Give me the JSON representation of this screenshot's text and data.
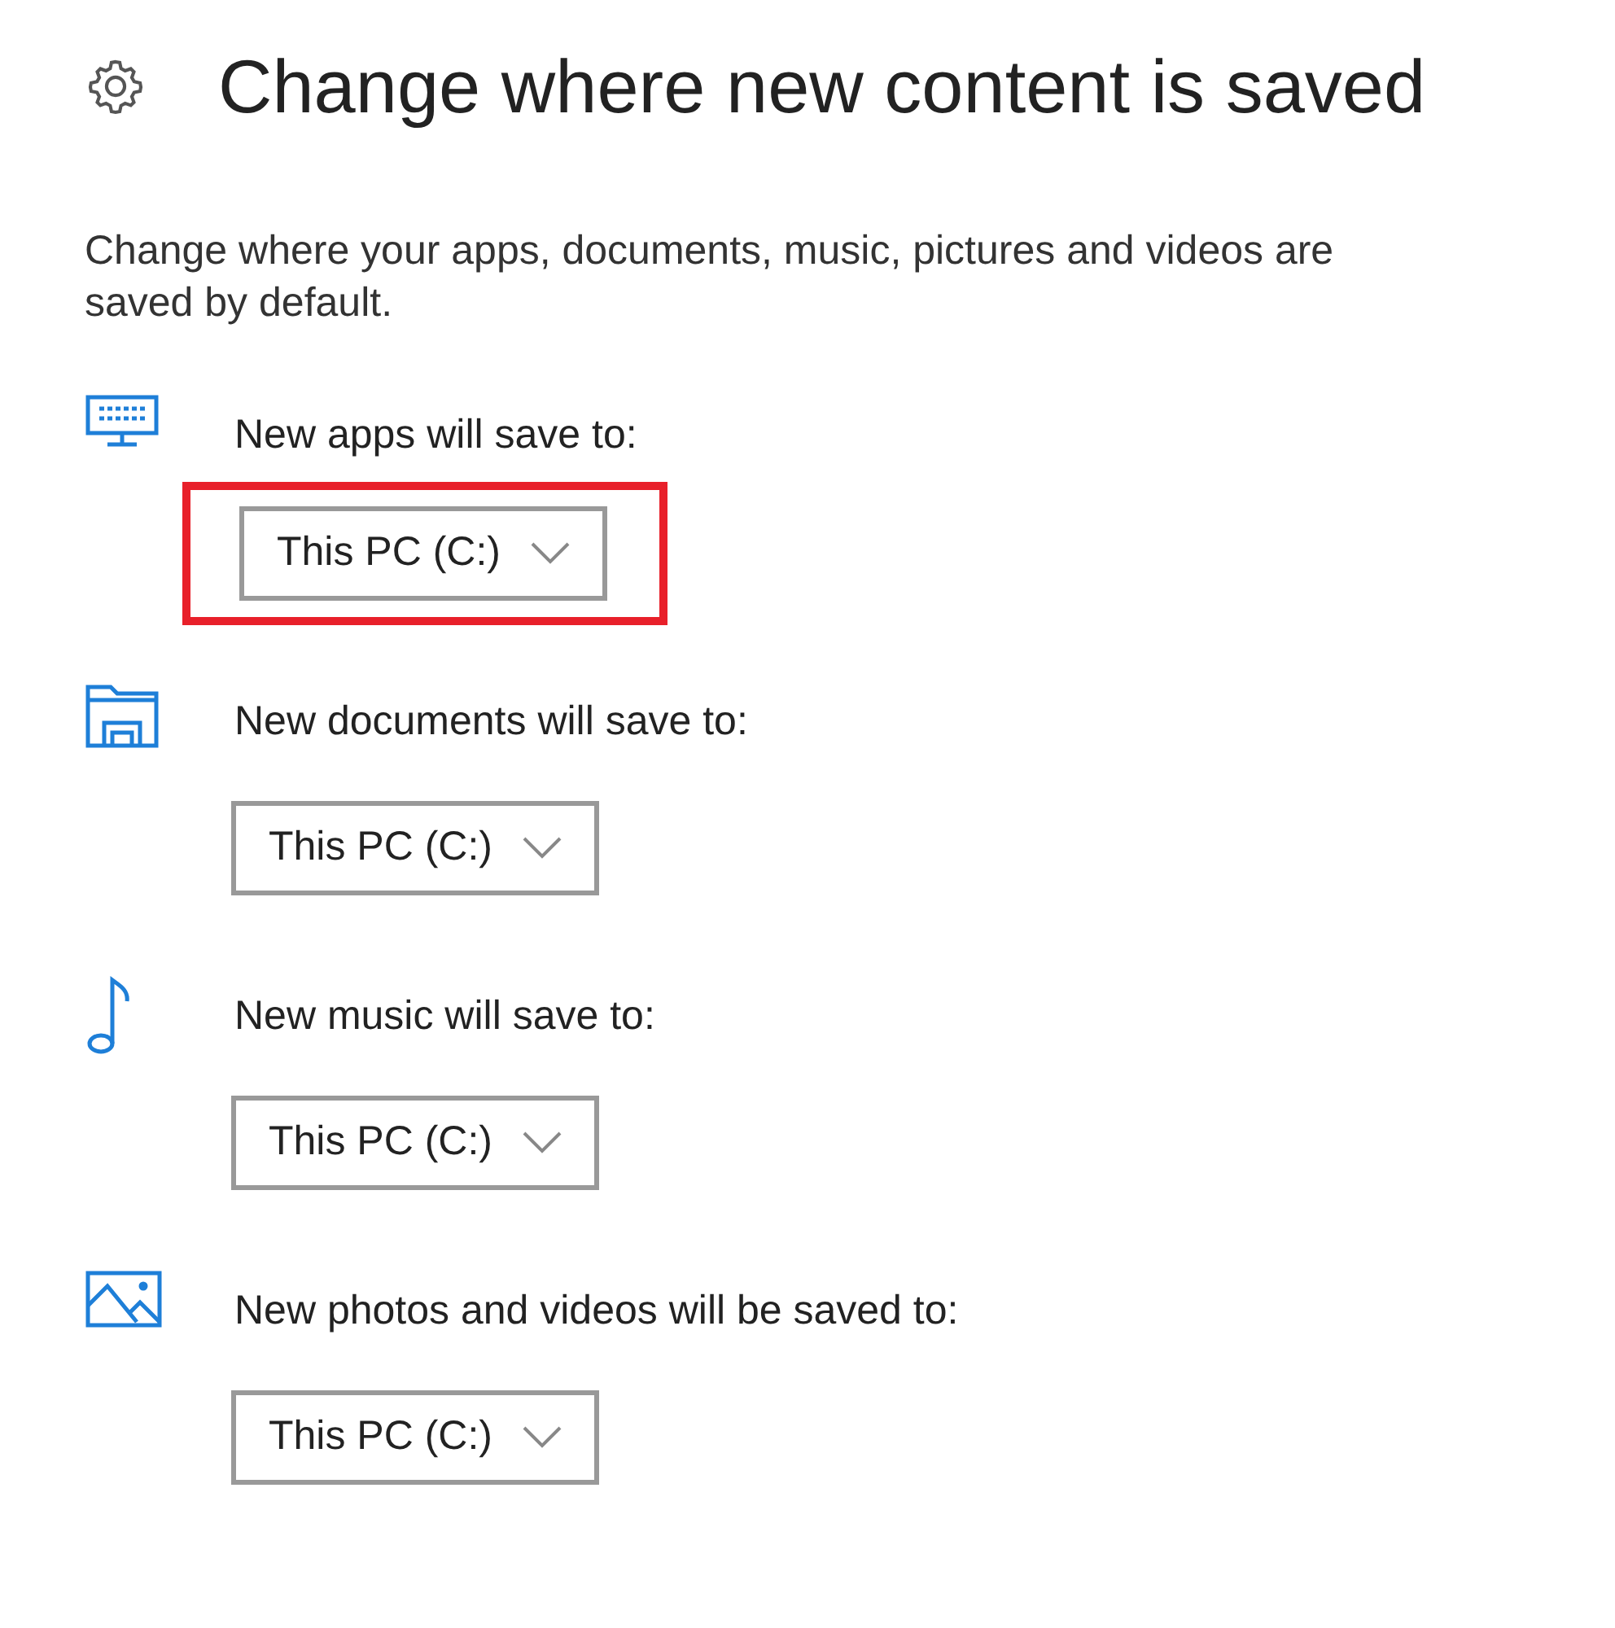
{
  "page": {
    "title": "Change where new content is saved",
    "description": "Change where your apps, documents, music, pictures and videos are saved by default."
  },
  "sections": [
    {
      "kind": "apps",
      "label": "New apps will save to:",
      "value": "This PC (C:)",
      "highlighted": true
    },
    {
      "kind": "documents",
      "label": "New documents will save to:",
      "value": "This PC (C:)",
      "highlighted": false
    },
    {
      "kind": "music",
      "label": "New music will save to:",
      "value": "This PC (C:)",
      "highlighted": false
    },
    {
      "kind": "photos",
      "label": "New photos and videos will be saved to:",
      "value": "This PC (C:)",
      "highlighted": false
    }
  ]
}
